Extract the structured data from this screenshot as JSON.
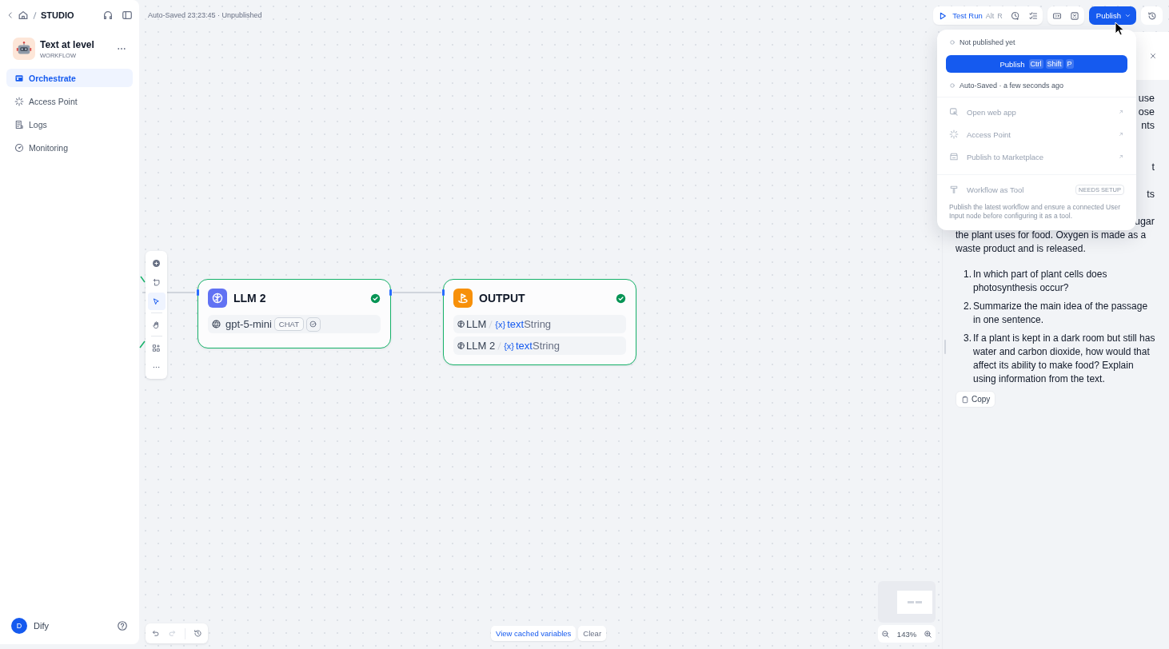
{
  "sidebar": {
    "breadcrumb": "STUDIO",
    "app": {
      "name": "Text at level",
      "type": "WORKFLOW"
    },
    "nav": [
      {
        "label": "Orchestrate",
        "kind": "orchestrate",
        "selected": true
      },
      {
        "label": "Access Point",
        "kind": "access",
        "selected": false
      },
      {
        "label": "Logs",
        "kind": "logs",
        "selected": false
      },
      {
        "label": "Monitoring",
        "kind": "monitoring",
        "selected": false
      }
    ],
    "user": {
      "initial": "D",
      "name": "Dify"
    }
  },
  "header": {
    "status": "Auto-Saved 23:23:45 · Unpublished",
    "test_run": {
      "label": "Test Run",
      "keys": [
        "Alt",
        "R"
      ]
    },
    "publish_button": "Publish"
  },
  "publish_menu": {
    "state": "Not published yet",
    "publish": {
      "label": "Publish",
      "keys": [
        "Ctrl",
        "Shift",
        "P"
      ]
    },
    "autosave": "Auto-Saved · a few seconds ago",
    "items": [
      {
        "label": "Open web app",
        "kind": "web",
        "disabled": true
      },
      {
        "label": "Access Point",
        "kind": "access",
        "disabled": true
      },
      {
        "label": "Publish to Marketplace",
        "kind": "market",
        "disabled": true
      }
    ],
    "tool": {
      "label": "Workflow as Tool",
      "badge": "NEEDS SETUP",
      "note": "Publish the latest workflow and ensure a connected User Input node before configuring it as a tool.",
      "disabled": true
    }
  },
  "canvas": {
    "tools": [
      {
        "kind": "add",
        "selected": false
      },
      {
        "kind": "note",
        "selected": false
      },
      {
        "kind": "pointer",
        "selected": true
      },
      {
        "kind": "hand",
        "selected": false
      },
      {
        "kind": "organize",
        "selected": false
      },
      {
        "kind": "more",
        "selected": false
      }
    ],
    "nodes": [
      {
        "kind": "llm",
        "title": "LLM 2",
        "model": "gpt-5-mini",
        "badge": "CHAT"
      },
      {
        "kind": "output",
        "title": "OUTPUT",
        "vars": [
          {
            "node": "LLM",
            "symbol": "{x}",
            "name": "text",
            "type": "String"
          },
          {
            "node": "LLM 2",
            "symbol": "{x}",
            "name": "text",
            "type": "String"
          }
        ]
      }
    ]
  },
  "result_panel": {
    "fragments": [
      "use",
      "ose",
      "nts",
      "t",
      "ts",
      "ugar"
    ],
    "paragraph": "the plant uses for food. Oxygen is made as a waste product and is released.",
    "questions": [
      {
        "number": "1.",
        "text": "In which part of plant cells does photosynthesis occur?"
      },
      {
        "number": "2.",
        "text": "Summarize the main idea of the passage in one sentence."
      },
      {
        "number": "3.",
        "text": "If a plant is kept in a dark room but still has water and carbon dioxide, how would that affect its ability to make food? Explain using information from the text."
      }
    ],
    "copy": "Copy"
  },
  "footer": {
    "cached": "View cached variables",
    "clear": "Clear",
    "zoom": "143%"
  }
}
